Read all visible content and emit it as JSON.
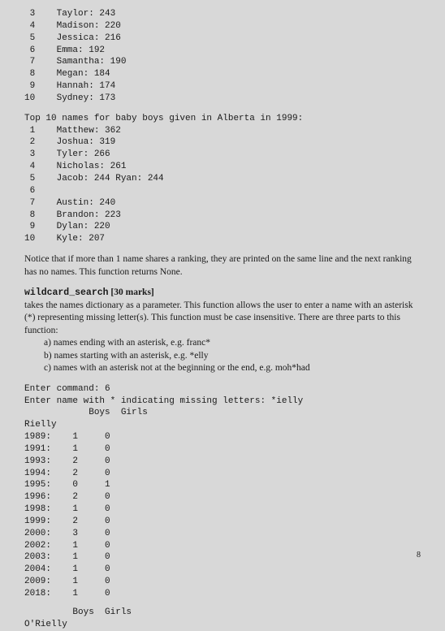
{
  "girl_names_tail": [
    {
      "rank": "3",
      "name": "Taylor",
      "count": "243"
    },
    {
      "rank": "4",
      "name": "Madison",
      "count": "220"
    },
    {
      "rank": "5",
      "name": "Jessica",
      "count": "216"
    },
    {
      "rank": "6",
      "name": "Emma",
      "count": "192"
    },
    {
      "rank": "7",
      "name": "Samantha",
      "count": "190"
    },
    {
      "rank": "8",
      "name": "Megan",
      "count": "184"
    },
    {
      "rank": "9",
      "name": "Hannah",
      "count": "174"
    },
    {
      "rank": "10",
      "name": "Sydney",
      "count": "173"
    }
  ],
  "boys_header": "Top 10 names for baby boys given in Alberta in 1999:",
  "boy_names": [
    {
      "rank": "1",
      "name": "Matthew",
      "count": "362",
      "extra": ""
    },
    {
      "rank": "2",
      "name": "Joshua",
      "count": "319",
      "extra": ""
    },
    {
      "rank": "3",
      "name": "Tyler",
      "count": "266",
      "extra": ""
    },
    {
      "rank": "4",
      "name": "Nicholas",
      "count": "261",
      "extra": ""
    },
    {
      "rank": "5",
      "name": "Jacob",
      "count": "244",
      "extra": " Ryan: 244"
    },
    {
      "rank": "6",
      "name": "",
      "count": "",
      "extra": ""
    },
    {
      "rank": "7",
      "name": "Austin",
      "count": "240",
      "extra": ""
    },
    {
      "rank": "8",
      "name": "Brandon",
      "count": "223",
      "extra": ""
    },
    {
      "rank": "9",
      "name": "Dylan",
      "count": "220",
      "extra": ""
    },
    {
      "rank": "10",
      "name": "Kyle",
      "count": "207",
      "extra": ""
    }
  ],
  "notice_text": "Notice that if more than 1 name shares a ranking, they are printed on the same line and the next ranking has no names. This function returns None.",
  "wildcard": {
    "title": "wildcard_search",
    "marks": " [30 marks]",
    "desc": "takes the names dictionary as a parameter. This function allows the user to enter a name with an asterisk (*) representing missing letter(s). This function must be case insensitive. There are three parts to this function:",
    "parts": [
      "a)  names ending with an asterisk, e.g. franc*",
      "b)  names starting with an asterisk, e.g. *elly",
      "c)  names with an asterisk not at the beginning or the end, e.g. moh*had"
    ]
  },
  "example": {
    "cmd_line": "Enter command: 6",
    "input_line": "Enter name with * indicating missing letters: *ielly",
    "header_spaces": "            Boys  Girls",
    "name1": "Rielly",
    "rows": [
      [
        "1989:",
        "1",
        "0"
      ],
      [
        "1991:",
        "1",
        "0"
      ],
      [
        "1993:",
        "2",
        "0"
      ],
      [
        "1994:",
        "2",
        "0"
      ],
      [
        "1995:",
        "0",
        "1"
      ],
      [
        "1996:",
        "2",
        "0"
      ],
      [
        "1998:",
        "1",
        "0"
      ],
      [
        "1999:",
        "2",
        "0"
      ],
      [
        "2000:",
        "3",
        "0"
      ],
      [
        "2002:",
        "1",
        "0"
      ],
      [
        "2003:",
        "1",
        "0"
      ],
      [
        "2004:",
        "1",
        "0"
      ],
      [
        "2009:",
        "1",
        "0"
      ],
      [
        "2018:",
        "1",
        "0"
      ]
    ],
    "footer_header": "         Boys  Girls",
    "name2": "O'Rielly"
  },
  "page_number": "8"
}
